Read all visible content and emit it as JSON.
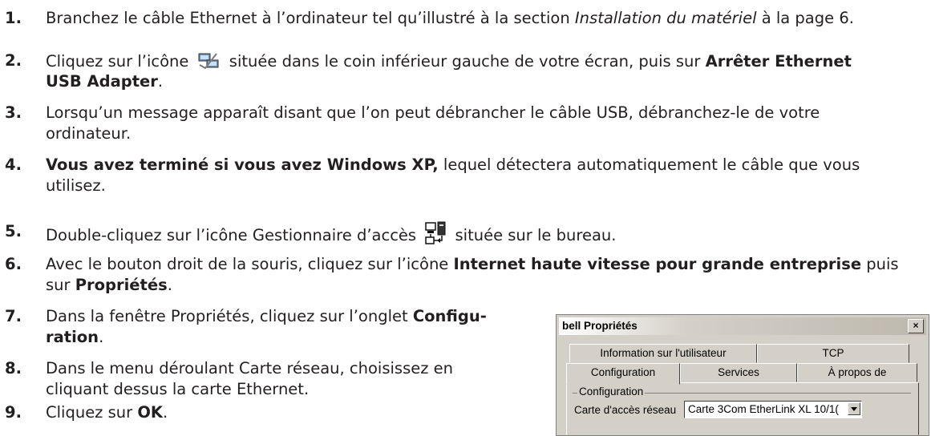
{
  "steps": [
    {
      "num": "1.",
      "a": "Branchez le câble Ethernet à l’ordinateur tel qu’illustré à la section ",
      "a_i": "Installation du matériel",
      "a2": " à la page 6."
    },
    {
      "num": "2.",
      "a": "Cliquez sur l’icône ",
      "icon": "network-tray-icon",
      "b": " située dans le coin inférieur gauche de votre écran, puis sur ",
      "b_bold": "Arrêter Ethernet",
      "line2_bold": "USB Adapter",
      "line2": "."
    },
    {
      "num": "3.",
      "a": "Lorsqu’un message apparaît disant que l’on peut débrancher le câble USB, débranchez-le de votre",
      "line2": "ordinateur."
    },
    {
      "num": "4.",
      "a_bold": "Vous avez terminé si vous avez Windows XP,",
      "a": " lequel détectera automatiquement le câble que vous",
      "line2": "utilisez."
    },
    {
      "num": "5.",
      "a": "Double-cliquez sur l’icône Gestionnaire d’accès ",
      "icon": "access-manager-icon",
      "b": " située sur le bureau."
    },
    {
      "num": "6.",
      "a": "Avec le bouton droit de la souris, cliquez sur l’icône ",
      "a_bold": "Internet haute vitesse pour grande entreprise",
      "a2": " puis",
      "line2_pre": "sur ",
      "line2_bold": "Propriétés",
      "line2": "."
    },
    {
      "num": "7.",
      "a": "Dans la fenêtre Propriétés, cliquez sur l’onglet ",
      "a_bold": "Configu-",
      "line2_bold": "ration",
      "line2": "."
    },
    {
      "num": "8.",
      "a": "Dans le menu déroulant Carte réseau, choisissez en",
      "line2": "cliquant dessus la carte Ethernet."
    },
    {
      "num": "9.",
      "a": "Cliquez sur ",
      "a_bold": "OK",
      "a2": "."
    }
  ],
  "dialog": {
    "title": "bell Propriétés",
    "close": "×",
    "tabs_back": [
      "Information sur l'utilisateur",
      "TCP"
    ],
    "tabs_front": [
      "Configuration",
      "Services",
      "À propos de"
    ],
    "group": "Configuration",
    "field_label": "Carte d'accès réseau",
    "field_value": "Carte 3Com EtherLink XL 10/1("
  }
}
